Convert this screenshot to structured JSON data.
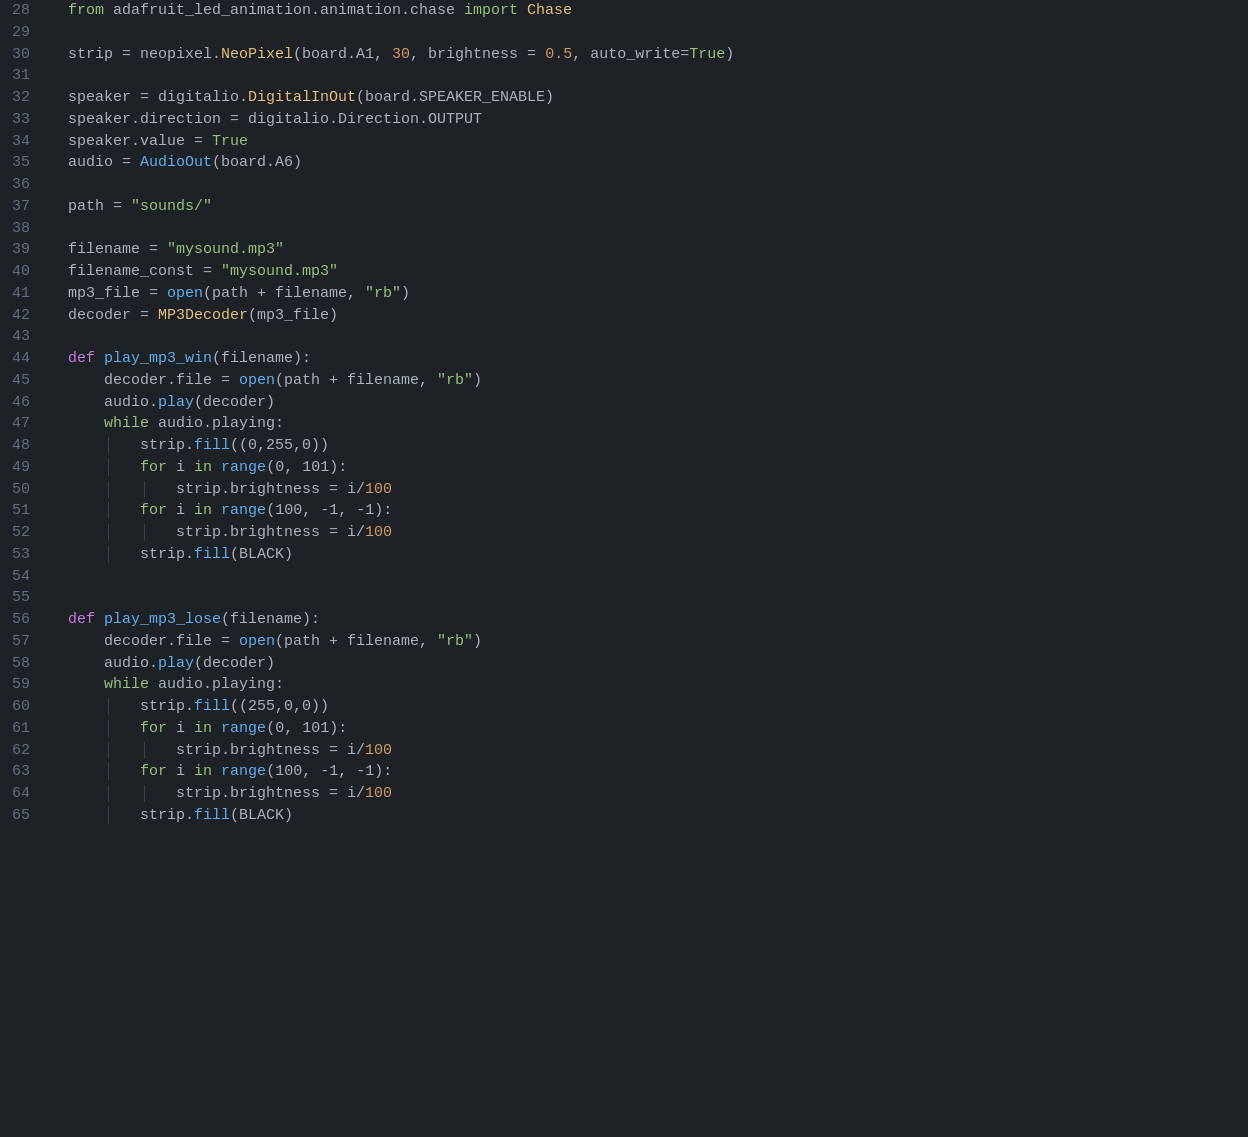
{
  "editor": {
    "background": "#1e2227",
    "lines": [
      {
        "num": 28,
        "tokens": [
          {
            "t": "kw-green",
            "v": "from"
          },
          {
            "t": "plain",
            "v": " adafruit_led_animation.animation.chase "
          },
          {
            "t": "kw-green",
            "v": "import"
          },
          {
            "t": "plain",
            "v": " "
          },
          {
            "t": "kw-yellow",
            "v": "Chase"
          }
        ]
      },
      {
        "num": 29,
        "tokens": []
      },
      {
        "num": 30,
        "tokens": [
          {
            "t": "plain",
            "v": "strip = neopixel."
          },
          {
            "t": "kw-yellow",
            "v": "NeoPixel"
          },
          {
            "t": "plain",
            "v": "(board.A1, "
          },
          {
            "t": "kw-orange",
            "v": "30"
          },
          {
            "t": "plain",
            "v": ", brightness = "
          },
          {
            "t": "kw-orange",
            "v": "0.5"
          },
          {
            "t": "plain",
            "v": ", auto_write="
          },
          {
            "t": "kw-green",
            "v": "True"
          },
          {
            "t": "plain",
            "v": ")"
          }
        ]
      },
      {
        "num": 31,
        "tokens": []
      },
      {
        "num": 32,
        "tokens": [
          {
            "t": "plain",
            "v": "speaker = digitalio."
          },
          {
            "t": "kw-yellow",
            "v": "DigitalInOut"
          },
          {
            "t": "plain",
            "v": "(board.SPEAKER_ENABLE)"
          }
        ]
      },
      {
        "num": 33,
        "tokens": [
          {
            "t": "plain",
            "v": "speaker.direction = digitalio.Direction.OUTPUT"
          }
        ]
      },
      {
        "num": 34,
        "tokens": [
          {
            "t": "plain",
            "v": "speaker.value = "
          },
          {
            "t": "kw-green",
            "v": "True"
          }
        ]
      },
      {
        "num": 35,
        "tokens": [
          {
            "t": "plain",
            "v": "audio = "
          },
          {
            "t": "kw-blue",
            "v": "AudioOut"
          },
          {
            "t": "plain",
            "v": "(board.A6)"
          }
        ]
      },
      {
        "num": 36,
        "tokens": []
      },
      {
        "num": 37,
        "tokens": [
          {
            "t": "plain",
            "v": "path = "
          },
          {
            "t": "str",
            "v": "\"sounds/\""
          }
        ]
      },
      {
        "num": 38,
        "tokens": []
      },
      {
        "num": 39,
        "tokens": [
          {
            "t": "plain",
            "v": "filename = "
          },
          {
            "t": "str",
            "v": "\"mysound.mp3\""
          }
        ]
      },
      {
        "num": 40,
        "tokens": [
          {
            "t": "plain",
            "v": "filename_const = "
          },
          {
            "t": "str",
            "v": "\"mysound.mp3\""
          }
        ]
      },
      {
        "num": 41,
        "tokens": [
          {
            "t": "plain",
            "v": "mp3_file = "
          },
          {
            "t": "kw-blue",
            "v": "open"
          },
          {
            "t": "plain",
            "v": "(path + filename, "
          },
          {
            "t": "str",
            "v": "\"rb\""
          },
          {
            "t": "plain",
            "v": ")"
          }
        ]
      },
      {
        "num": 42,
        "tokens": [
          {
            "t": "plain",
            "v": "decoder = "
          },
          {
            "t": "kw-yellow",
            "v": "MP3Decoder"
          },
          {
            "t": "plain",
            "v": "(mp3_file)"
          }
        ]
      },
      {
        "num": 43,
        "tokens": []
      },
      {
        "num": 44,
        "tokens": [
          {
            "t": "kw-purple",
            "v": "def"
          },
          {
            "t": "plain",
            "v": " "
          },
          {
            "t": "kw-blue",
            "v": "play_mp3_win"
          },
          {
            "t": "plain",
            "v": "(filename):"
          }
        ]
      },
      {
        "num": 45,
        "tokens": [
          {
            "t": "plain",
            "v": "    decoder.file = "
          },
          {
            "t": "kw-blue",
            "v": "open"
          },
          {
            "t": "plain",
            "v": "(path + filename, "
          },
          {
            "t": "str",
            "v": "\"rb\""
          },
          {
            "t": "plain",
            "v": ")"
          }
        ]
      },
      {
        "num": 46,
        "tokens": [
          {
            "t": "plain",
            "v": "    audio."
          },
          {
            "t": "kw-blue",
            "v": "play"
          },
          {
            "t": "plain",
            "v": "(decoder)"
          }
        ]
      },
      {
        "num": 47,
        "tokens": [
          {
            "t": "plain",
            "v": "    "
          },
          {
            "t": "kw-green",
            "v": "while"
          },
          {
            "t": "plain",
            "v": " audio.playing:"
          }
        ]
      },
      {
        "num": 48,
        "tokens": [
          {
            "t": "plain",
            "v": "    │   strip."
          },
          {
            "t": "kw-blue",
            "v": "fill"
          },
          {
            "t": "plain",
            "v": "((0,255,0))"
          }
        ]
      },
      {
        "num": 49,
        "tokens": [
          {
            "t": "plain",
            "v": "    │   "
          },
          {
            "t": "kw-green",
            "v": "for"
          },
          {
            "t": "plain",
            "v": " i "
          },
          {
            "t": "kw-green",
            "v": "in"
          },
          {
            "t": "plain",
            "v": " "
          },
          {
            "t": "kw-blue",
            "v": "range"
          },
          {
            "t": "plain",
            "v": "(0, 101):"
          }
        ]
      },
      {
        "num": 50,
        "tokens": [
          {
            "t": "plain",
            "v": "    │   │   strip.brightness = i/"
          },
          {
            "t": "kw-orange",
            "v": "100"
          }
        ]
      },
      {
        "num": 51,
        "tokens": [
          {
            "t": "plain",
            "v": "    │   "
          },
          {
            "t": "kw-green",
            "v": "for"
          },
          {
            "t": "plain",
            "v": " i "
          },
          {
            "t": "kw-green",
            "v": "in"
          },
          {
            "t": "plain",
            "v": " "
          },
          {
            "t": "kw-blue",
            "v": "range"
          },
          {
            "t": "plain",
            "v": "(100, -1, -1):"
          }
        ]
      },
      {
        "num": 52,
        "tokens": [
          {
            "t": "plain",
            "v": "    │   │   strip.brightness = i/"
          },
          {
            "t": "kw-orange",
            "v": "100"
          }
        ]
      },
      {
        "num": 53,
        "tokens": [
          {
            "t": "plain",
            "v": "    │   strip."
          },
          {
            "t": "kw-blue",
            "v": "fill"
          },
          {
            "t": "plain",
            "v": "(BLACK)"
          }
        ]
      },
      {
        "num": 54,
        "tokens": []
      },
      {
        "num": 55,
        "tokens": []
      },
      {
        "num": 56,
        "tokens": [
          {
            "t": "kw-purple",
            "v": "def"
          },
          {
            "t": "plain",
            "v": " "
          },
          {
            "t": "kw-blue",
            "v": "play_mp3_lose"
          },
          {
            "t": "plain",
            "v": "(filename):"
          }
        ]
      },
      {
        "num": 57,
        "tokens": [
          {
            "t": "plain",
            "v": "    decoder.file = "
          },
          {
            "t": "kw-blue",
            "v": "open"
          },
          {
            "t": "plain",
            "v": "(path + filename, "
          },
          {
            "t": "str",
            "v": "\"rb\""
          },
          {
            "t": "plain",
            "v": ")"
          }
        ]
      },
      {
        "num": 58,
        "tokens": [
          {
            "t": "plain",
            "v": "    audio."
          },
          {
            "t": "kw-blue",
            "v": "play"
          },
          {
            "t": "plain",
            "v": "(decoder)"
          }
        ]
      },
      {
        "num": 59,
        "tokens": [
          {
            "t": "plain",
            "v": "    "
          },
          {
            "t": "kw-green",
            "v": "while"
          },
          {
            "t": "plain",
            "v": " audio.playing:"
          }
        ]
      },
      {
        "num": 60,
        "tokens": [
          {
            "t": "plain",
            "v": "    │   strip."
          },
          {
            "t": "kw-blue",
            "v": "fill"
          },
          {
            "t": "plain",
            "v": "((255,0,0))"
          }
        ]
      },
      {
        "num": 61,
        "tokens": [
          {
            "t": "plain",
            "v": "    │   "
          },
          {
            "t": "kw-green",
            "v": "for"
          },
          {
            "t": "plain",
            "v": " i "
          },
          {
            "t": "kw-green",
            "v": "in"
          },
          {
            "t": "plain",
            "v": " "
          },
          {
            "t": "kw-blue",
            "v": "range"
          },
          {
            "t": "plain",
            "v": "(0, 101):"
          }
        ]
      },
      {
        "num": 62,
        "tokens": [
          {
            "t": "plain",
            "v": "    │   │   strip.brightness = i/"
          },
          {
            "t": "kw-orange",
            "v": "100"
          }
        ]
      },
      {
        "num": 63,
        "tokens": [
          {
            "t": "plain",
            "v": "    │   "
          },
          {
            "t": "kw-green",
            "v": "for"
          },
          {
            "t": "plain",
            "v": " i "
          },
          {
            "t": "kw-green",
            "v": "in"
          },
          {
            "t": "plain",
            "v": " "
          },
          {
            "t": "kw-blue",
            "v": "range"
          },
          {
            "t": "plain",
            "v": "(100, -1, -1):"
          }
        ]
      },
      {
        "num": 64,
        "tokens": [
          {
            "t": "plain",
            "v": "    │   │   strip.brightness = i/"
          },
          {
            "t": "kw-orange",
            "v": "100"
          }
        ]
      },
      {
        "num": 65,
        "tokens": [
          {
            "t": "plain",
            "v": "    │   strip."
          },
          {
            "t": "kw-blue",
            "v": "fill"
          },
          {
            "t": "plain",
            "v": "(BLACK)"
          }
        ]
      }
    ]
  }
}
